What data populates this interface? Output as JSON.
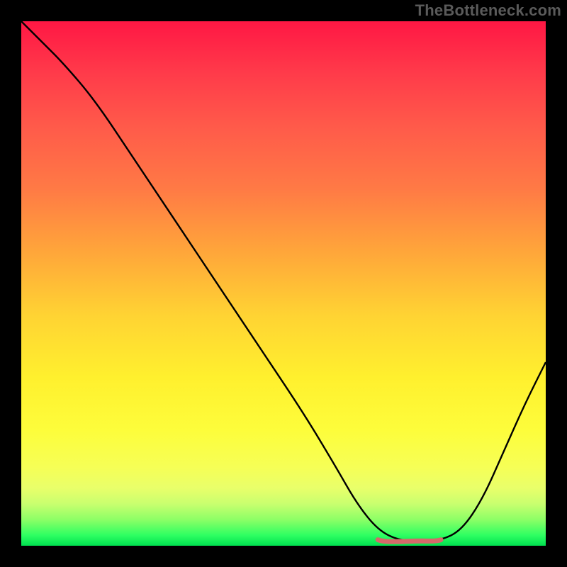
{
  "watermark": "TheBottleneck.com",
  "chart_data": {
    "type": "line",
    "title": "",
    "xlabel": "",
    "ylabel": "",
    "xlim": [
      0,
      100
    ],
    "ylim": [
      0,
      100
    ],
    "grid": false,
    "note": "Headless bottleneck-style V-curve. Axes unlabeled; values are normalized 0–100 estimated from pixel positions. y is height of the curve from bottom.",
    "series": [
      {
        "name": "curve",
        "x": [
          0,
          4,
          8,
          14,
          22,
          30,
          38,
          46,
          54,
          60,
          64,
          68,
          72,
          76,
          80,
          84,
          88,
          92,
          96,
          100
        ],
        "y": [
          100,
          96,
          92,
          85,
          73,
          61,
          49,
          37,
          25,
          15,
          8,
          3,
          1,
          1,
          1,
          3,
          9,
          18,
          27,
          35
        ]
      }
    ],
    "highlight": {
      "name": "flat-minimum-segment",
      "x_range": [
        68,
        80
      ],
      "y": 1,
      "color": "#d46a6a"
    },
    "gradient_stops": [
      {
        "pos": 0.0,
        "color": "#ff1744"
      },
      {
        "pos": 0.1,
        "color": "#ff3b4a"
      },
      {
        "pos": 0.2,
        "color": "#ff5a4a"
      },
      {
        "pos": 0.32,
        "color": "#ff7a45"
      },
      {
        "pos": 0.44,
        "color": "#ffa63a"
      },
      {
        "pos": 0.56,
        "color": "#ffd333"
      },
      {
        "pos": 0.68,
        "color": "#fff02e"
      },
      {
        "pos": 0.78,
        "color": "#fdfd3b"
      },
      {
        "pos": 0.85,
        "color": "#f6ff56"
      },
      {
        "pos": 0.89,
        "color": "#e9ff6a"
      },
      {
        "pos": 0.92,
        "color": "#c9ff6f"
      },
      {
        "pos": 0.95,
        "color": "#8dff66"
      },
      {
        "pos": 0.98,
        "color": "#2eff62"
      },
      {
        "pos": 1.0,
        "color": "#00e050"
      }
    ]
  }
}
